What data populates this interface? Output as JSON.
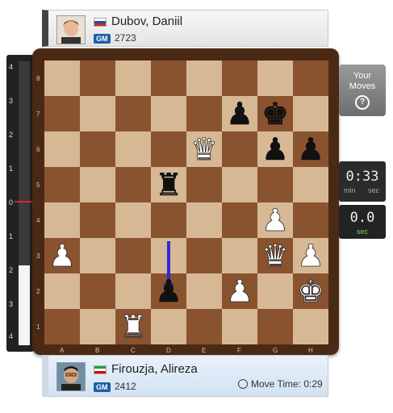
{
  "top_player": {
    "name": "Dubov, Daniil",
    "title": "GM",
    "rating": "2723",
    "flag": "russia-flag"
  },
  "bottom_player": {
    "name": "Firouzja, Alireza",
    "title": "GM",
    "rating": "2412",
    "flag": "iran-flag",
    "move_time": "Move Time: 0:29"
  },
  "eval_bar": {
    "ticks": [
      "4",
      "3",
      "2",
      "1",
      "0",
      "1",
      "2",
      "3",
      "4"
    ],
    "white_fill_fraction": 0.28
  },
  "side_panel": {
    "your_moves_line1": "Your",
    "your_moves_line2": "Moves",
    "help_glyph": "?"
  },
  "clock": {
    "time": "0:33",
    "unit_min": "min",
    "unit_sec": "sec",
    "time2": "0.0",
    "unit2": "sec"
  },
  "board": {
    "files": [
      "A",
      "B",
      "C",
      "D",
      "E",
      "F",
      "G",
      "H"
    ],
    "ranks": [
      "8",
      "7",
      "6",
      "5",
      "4",
      "3",
      "2",
      "1"
    ],
    "pieces": [
      {
        "square": "f7",
        "piece": "black-pawn",
        "glyph": "♟"
      },
      {
        "square": "g7",
        "piece": "black-king",
        "glyph": "♚"
      },
      {
        "square": "e6",
        "piece": "white-queen",
        "glyph": "♕"
      },
      {
        "square": "g6",
        "piece": "black-pawn",
        "glyph": "♟"
      },
      {
        "square": "h6",
        "piece": "black-pawn",
        "glyph": "♟"
      },
      {
        "square": "d5",
        "piece": "black-rook",
        "glyph": "♜"
      },
      {
        "square": "g4",
        "piece": "white-pawn",
        "glyph": "♙"
      },
      {
        "square": "a3",
        "piece": "white-pawn",
        "glyph": "♙"
      },
      {
        "square": "g3",
        "piece": "white-queen",
        "glyph": "♕"
      },
      {
        "square": "h3",
        "piece": "white-pawn",
        "glyph": "♙"
      },
      {
        "square": "d2",
        "piece": "black-pawn",
        "glyph": "♟"
      },
      {
        "square": "f2",
        "piece": "white-pawn",
        "glyph": "♙"
      },
      {
        "square": "h2",
        "piece": "white-king",
        "glyph": "♔"
      },
      {
        "square": "c1",
        "piece": "white-rook",
        "glyph": "♖"
      }
    ],
    "last_move_arrow": {
      "from": "d3",
      "to": "d2",
      "color": "#2a2ad8"
    }
  },
  "colors": {
    "light_square": "#d7b894",
    "dark_square": "#8a5330",
    "frame": "#4a2a14",
    "eval_zero": "#dd2222"
  }
}
